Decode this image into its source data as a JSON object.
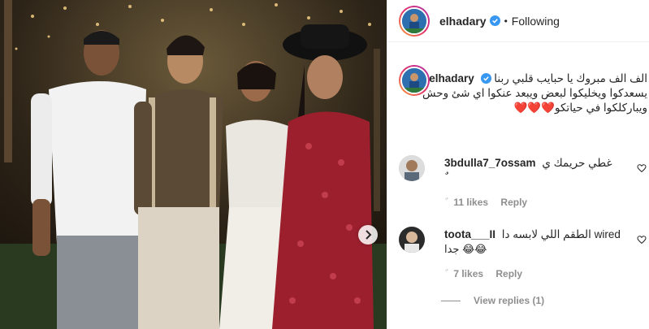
{
  "post": {
    "username": "elhadary",
    "separator": "•",
    "follow_state": "Following"
  },
  "caption": {
    "username": "elhadary",
    "lines": [
      "الف الف مبروك يا حبايب قلبي ربنا",
      "يسعدكوا ويخليكوا لبعض ويبعد عنكوا اي شئ وحش",
      "ويباركلكوا في حياتكو❤️❤️❤️"
    ]
  },
  "comments": [
    {
      "username": "3bdulla7_7ossam",
      "text": "غطي حريمك ي",
      "text2": "ٌ",
      "likes": "11 likes",
      "reply": "Reply"
    },
    {
      "username": "toota___II",
      "text": "الطقم اللي لابسه دا wired",
      "text2": "جدا 😂😂",
      "likes": "7 likes",
      "reply": "Reply"
    }
  ],
  "view_replies": "View replies (1)",
  "icons": {
    "verified": "verified-badge-icon",
    "heart": "heart-outline-icon",
    "next": "chevron-right-icon"
  },
  "colors": {
    "verified_blue": "#3897f0",
    "meta_gray": "#8e8e8e",
    "text": "#262626"
  }
}
